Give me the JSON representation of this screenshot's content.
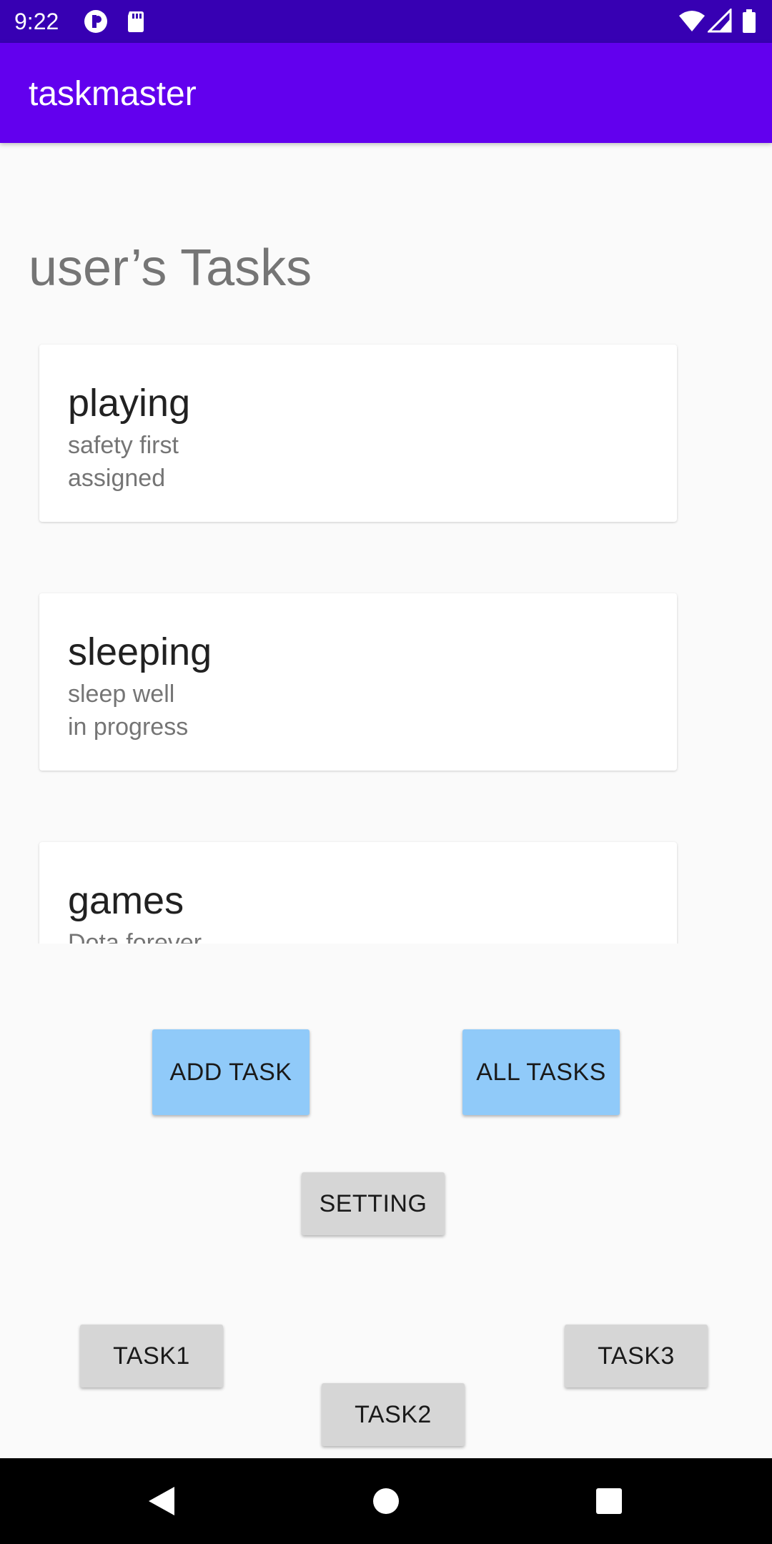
{
  "status_bar": {
    "time": "9:22",
    "icons": [
      "app-notification-icon",
      "sd-card-icon",
      "wifi-icon",
      "signal-icon",
      "battery-icon"
    ]
  },
  "app_bar": {
    "title": "taskmaster"
  },
  "heading": "user’s Tasks",
  "tasks": [
    {
      "title": "playing",
      "body": "safety first",
      "state": "assigned"
    },
    {
      "title": "sleeping",
      "body": "sleep well",
      "state": "in progress"
    },
    {
      "title": "games",
      "body": "Dota forever",
      "state": ""
    }
  ],
  "buttons": {
    "add_task": "ADD TASK",
    "all_tasks": "ALL TASKS",
    "setting": "SETTING",
    "task1": "TASK1",
    "task2": "TASK2",
    "task3": "TASK3"
  },
  "nav_bar": {
    "icons": [
      "back-icon",
      "home-icon",
      "recents-icon"
    ]
  },
  "colors": {
    "status_bar": "#3700b3",
    "app_bar": "#6200ee",
    "primary_button": "#90caf9",
    "secondary_button": "#d6d6d6"
  }
}
